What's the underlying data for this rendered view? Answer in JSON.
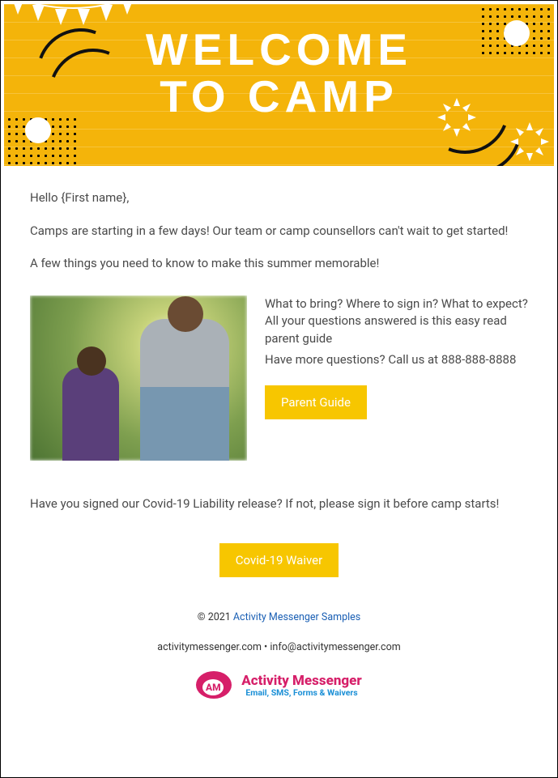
{
  "hero": {
    "title_line1": "WELCOME",
    "title_line2": "TO CAMP"
  },
  "intro": {
    "greeting": "Hello {First name},",
    "p1": "Camps are starting in a few days! Our team or camp counsellors can't wait to get started!",
    "p2": "A few things you need to know to make this summer memorable!"
  },
  "guide_block": {
    "text1": "What to bring? Where to sign in? What to expect? All your questions answered is this easy read parent guide",
    "text2": "Have more questions? Call us at 888-888-8888",
    "button_label": "Parent Guide"
  },
  "waiver_block": {
    "text": "Have you signed our Covid-19 Liability release? If not, please sign it before camp starts!",
    "button_label": "Covid-19 Waiver"
  },
  "footer": {
    "copyright_prefix": "© 2021 ",
    "org_link": "Activity Messenger Samples",
    "site": "activitymessenger.com",
    "separator": " • ",
    "email": "info@activitymessenger.com",
    "logo_initials": "AM",
    "logo_title": "Activity Messenger",
    "logo_subtitle": "Email, SMS, Forms &  Waivers"
  }
}
